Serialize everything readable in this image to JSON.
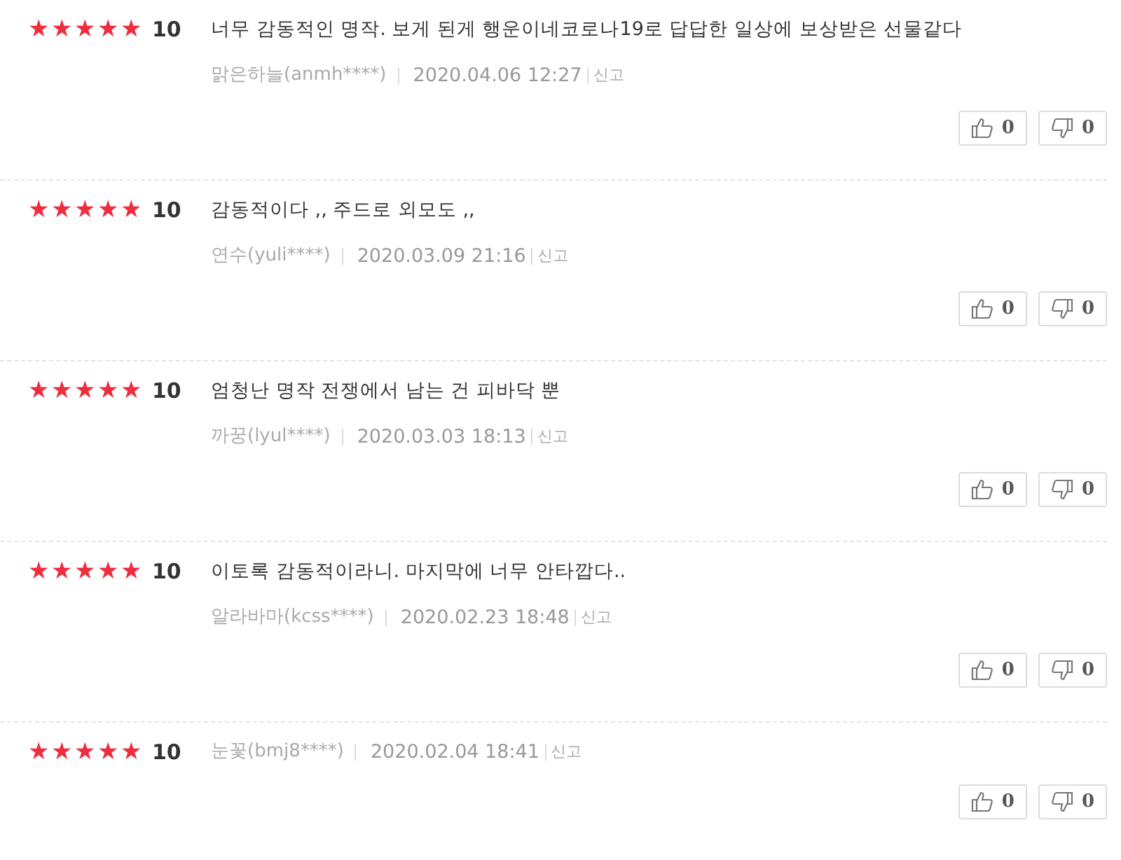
{
  "reviews": [
    {
      "stars": 5,
      "score": "10",
      "comment": "너무 감동적인 명작. 보게 된게 행운이네코로나19로 답답한 일상에 보상받은 선물같다",
      "author": "맑은하늘(anmh****)",
      "date": "2020.04.06 12:27",
      "report": "신고",
      "likes": "0",
      "dislikes": "0"
    },
    {
      "stars": 5,
      "score": "10",
      "comment": "감동적이다 ,, 주드로 외모도 ,,",
      "author": "연수(yuli****)",
      "date": "2020.03.09 21:16",
      "report": "신고",
      "likes": "0",
      "dislikes": "0"
    },
    {
      "stars": 5,
      "score": "10",
      "comment": "엄청난 명작 전쟁에서 남는 건 피바닥 뿐",
      "author": "까꿍(lyul****)",
      "date": "2020.03.03 18:13",
      "report": "신고",
      "likes": "0",
      "dislikes": "0"
    },
    {
      "stars": 5,
      "score": "10",
      "comment": "이토록 감동적이라니. 마지막에 너무 안타깝다..",
      "author": "알라바마(kcss****)",
      "date": "2020.02.23 18:48",
      "report": "신고",
      "likes": "0",
      "dislikes": "0"
    },
    {
      "stars": 5,
      "score": "10",
      "author": "눈꽃(bmj8****)",
      "date": "2020.02.04 18:41",
      "report": "신고",
      "likes": "0",
      "dislikes": "0"
    }
  ]
}
